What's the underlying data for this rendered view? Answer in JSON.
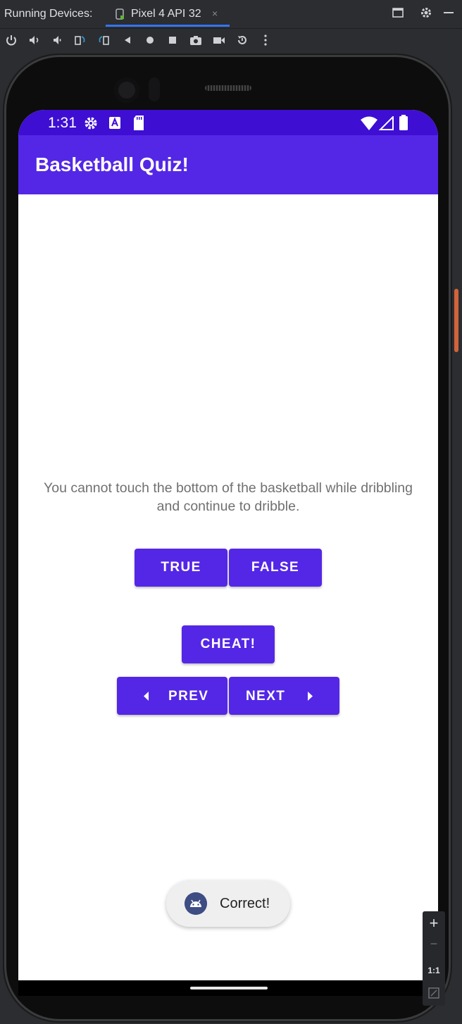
{
  "ide": {
    "running_devices_label": "Running Devices:",
    "device_tab": "Pixel 4 API 32",
    "tab_close": "×",
    "toolbar_icons": [
      "power-icon",
      "volume-up-icon",
      "volume-down-icon",
      "rotate-left-icon",
      "rotate-right-icon",
      "back-icon",
      "home-icon",
      "overview-icon",
      "screenshot-icon",
      "screen-record-icon",
      "reset-icon",
      "more-icon"
    ],
    "window_icons": [
      "maximize-icon",
      "settings-icon",
      "minimize-icon"
    ]
  },
  "phone": {
    "status": {
      "time": "1:31"
    },
    "app_title": "Basketball Quiz!",
    "question": "You cannot touch the bottom of the basketball while dribbling and continue to dribble.",
    "buttons": {
      "true_label": "TRUE",
      "false_label": "FALSE",
      "cheat_label": "CHEAT!",
      "prev_label": "PREV",
      "next_label": "NEXT"
    },
    "toast": "Correct!"
  },
  "zoom": {
    "plus": "+",
    "minus": "−",
    "one_to_one": "1:1"
  },
  "colors": {
    "primary": "#5427e6",
    "primary_dark": "#3e0ed3",
    "ide_bg": "#2b2d30"
  }
}
